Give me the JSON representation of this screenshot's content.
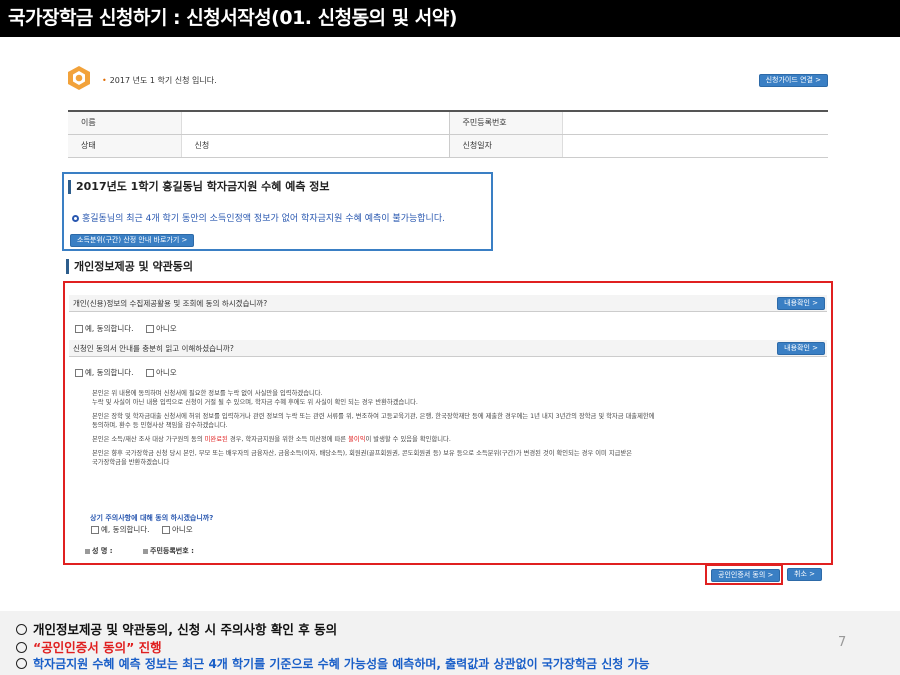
{
  "slide_title": "국가장학금 신청하기 : 신청서작성(01. 신청동의 및 서약)",
  "notice": {
    "text": "2017 년도 1 학기 신청 입니다.",
    "guide_button": "신청가이드 연결 >"
  },
  "info_table": {
    "row1": {
      "label1": "이름",
      "value1": "",
      "label2": "주민등록번호",
      "value2": ""
    },
    "row2": {
      "label1": "상태",
      "value1": "신청",
      "label2": "신청일자",
      "value2": ""
    }
  },
  "prediction": {
    "title": "2017년도 1학기 홍길동님 학자금지원 수혜 예측 정보",
    "message": "홍길동님의 최근 4개 학기 동안의 소득인정액 정보가 없어 학자금지원 수혜 예측이 불가능합니다.",
    "button": "소득분위(구간) 산정 안내 바로가기 >"
  },
  "section_title": "개인정보제공 및 약관동의",
  "consent": {
    "q1": "개인(신용)정보의 수집제공활용 및 조회에 동의 하시겠습니까?",
    "q1_button": "내용확인 >",
    "q2": "신청인 동의서 안내를 충분히 읽고 이해하셨습니까?",
    "q2_button": "내용확인 >",
    "yes": "예, 동의합니다.",
    "no": "아니오",
    "terms": [
      "본인은 위 내용에 동의하며 신청서에 필요한 정보를 누락 없이 사실만을 입력하겠습니다.",
      "누락 및 사실이 아닌 내용 입력으로 신청이 거절 될 수 있으며, 학자금 수혜 후에도 위 사실이 확인 되는 경우 반환하겠습니다.",
      "본인은 장학 및 학자금대출 신청서에 허위 정보를 입력하거나 관련 정보의 누락 또는 관련 서류를 위, 변조하여 고등교육기관, 은행, 한국장학재단 등에 제출한 경우에는 1년 내지 3년간의 장학금 및 학자금 대출제한에",
      "동의하며, 환수 등 민형사상 책임을 감수하겠습니다.",
      "본인은 소득/재산 조사 대상 가구원의 동의 ",
      "미완료된",
      " 경우, 학자금지원을 위한 소득 미산정에 따른 ",
      "불이익",
      "이 발생할 수 있음을 확인합니다.",
      "본인은 향후 국가장학금 신청 당시 본인, 부모 또는 배우자의 금융자산, 금융소득(이자, 배당소득), 회원권(골프회원권, 콘도회원권 등) 보유 등으로 소득분위(구간)가 변경된 것이 확인되는 경우 이미 지급받은",
      "국가장학금을 반환하겠습니다"
    ],
    "sub_question": "상기 주의사항에 대해 동의 하시겠습니까?",
    "sign_name": "성 명 :",
    "sign_id": "주민등록번호 :"
  },
  "buttons": {
    "cert": "공인인증서 동의 >",
    "cancel": "취소 >"
  },
  "bottom": {
    "line1": "개인정보제공 및 약관동의, 신청 시 주의사항 확인 후 동의",
    "line2": "“공인인증서 동의” 진행",
    "line3": "학자금지원 수혜 예측 정보는 최근 4개 학기를 기준으로 수혜 가능성을 예측하며, 출력값과 상관없이 국가장학금 신청 가능",
    "page": "7"
  },
  "colors": {
    "accent_blue": "#3a7fc4",
    "highlight_red": "#e02020",
    "bottom_red": "#e02020",
    "bottom_blue": "#1a5fc8"
  }
}
